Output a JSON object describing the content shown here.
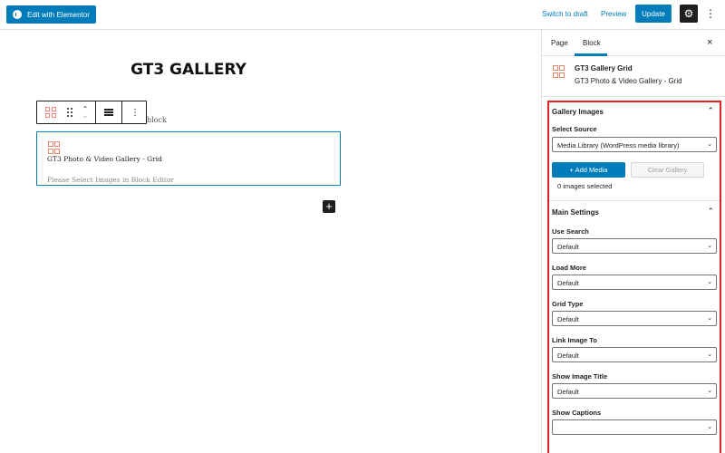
{
  "topbar": {
    "elementor_label": "Edit with Elementor",
    "switch_draft": "Switch to draft",
    "preview": "Preview",
    "update": "Update",
    "settings_glyph": "⚙",
    "more_glyph": "⋮"
  },
  "editor": {
    "post_title": "GT3 GALLERY",
    "block_hint": "block",
    "gallery_block": {
      "title": "GT3 Photo & Video Gallery - Grid",
      "hint": "Please Select Images in Block Editor"
    },
    "add_block_glyph": "+"
  },
  "sidebar": {
    "tabs": {
      "page": "Page",
      "block": "Block"
    },
    "close_glyph": "×",
    "block_card": {
      "name": "GT3 Gallery Grid",
      "description": "GT3 Photo & Video Gallery - Grid"
    },
    "gallery_images": {
      "heading": "Gallery Images",
      "source_label": "Select Source",
      "source_value": "Media Library (WordPress media library)",
      "add_media": "+ Add Media",
      "clear_gallery": "Clear Gallery",
      "count_text": "0 images selected"
    },
    "main_settings": {
      "heading": "Main Settings",
      "fields": [
        {
          "label": "Use Search",
          "value": "Default"
        },
        {
          "label": "Load More",
          "value": "Default"
        },
        {
          "label": "Grid Type",
          "value": "Default"
        },
        {
          "label": "Link Image To",
          "value": "Default"
        },
        {
          "label": "Show Image Title",
          "value": "Default"
        },
        {
          "label": "Show Captions",
          "value": ""
        }
      ]
    }
  },
  "colors": {
    "accent": "#007cba",
    "highlight_border": "#e02424",
    "icon_orange": "#f0886f"
  }
}
